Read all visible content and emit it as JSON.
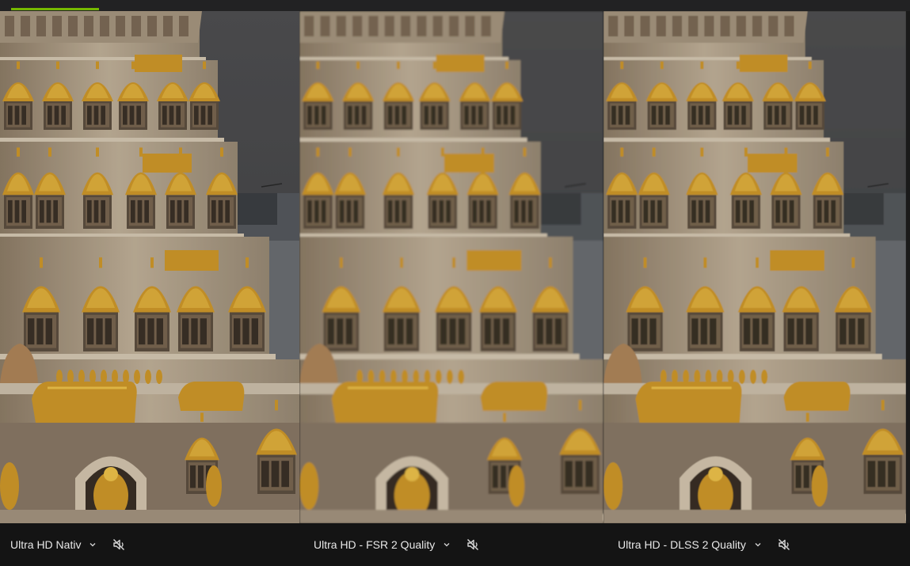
{
  "topbar": {
    "progress_fraction": 0.097
  },
  "panes": [
    {
      "id": "native",
      "label": "Ultra HD Nativ",
      "blur": 0
    },
    {
      "id": "fsr",
      "label": "Ultra HD - FSR 2 Quality",
      "blur": 1.1
    },
    {
      "id": "dlss",
      "label": "Ultra HD - DLSS 2 Quality",
      "blur": 0.4
    }
  ],
  "icons": {
    "dropdown": "chevron-down-icon",
    "mute": "speaker-muted-icon"
  },
  "colors": {
    "accent": "#76b900",
    "sky": "#4a4a4c",
    "stone": "#b5a58f",
    "stone_dark": "#5e5040",
    "gold": "#d19a2a",
    "gold_light": "#f0c44a",
    "label_text": "#e8e8e8"
  }
}
